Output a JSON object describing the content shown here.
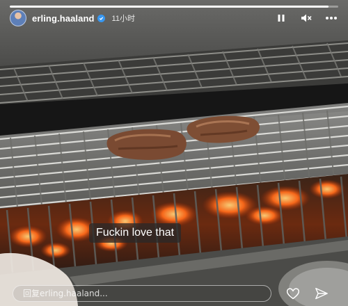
{
  "story": {
    "username": "erling.haaland",
    "time_ago": "11小时",
    "caption": "Fuckin love that",
    "progress": 0.97
  },
  "reply": {
    "placeholder": "回复erling.haaland..."
  },
  "icons": {
    "verified": "verified-badge-icon",
    "pause": "pause-icon",
    "mute": "speaker-mute-icon",
    "more": "more-horizontal-icon",
    "like": "heart-icon",
    "share": "send-icon"
  },
  "colors": {
    "verified": "#3897f0",
    "embers": "#ff6a1a"
  }
}
